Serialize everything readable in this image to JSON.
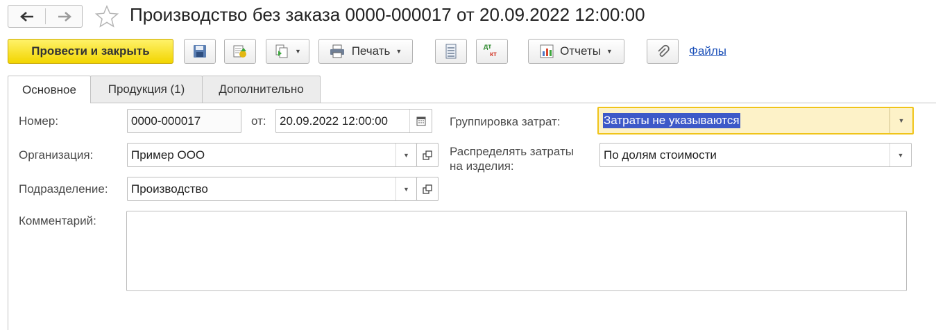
{
  "window": {
    "title": "Производство без заказа 0000-000017 от 20.09.2022 12:00:00"
  },
  "nav": {
    "back_icon": "arrow-left-icon",
    "forward_icon": "arrow-right-icon",
    "favorite_icon": "star-icon"
  },
  "toolbar": {
    "post_and_close_label": "Провести и закрыть",
    "print_label": "Печать",
    "reports_label": "Отчеты",
    "files_link": "Файлы",
    "icons": [
      "save-icon",
      "post-icon",
      "create-based-on-icon",
      "printer-icon",
      "list-icon",
      "dt-kt-icon",
      "reports-icon",
      "attachment-icon"
    ],
    "dt_text": "дт",
    "kt_text": "кт"
  },
  "tabs": [
    {
      "label": "Основное",
      "active": true
    },
    {
      "label": "Продукция (1)",
      "active": false
    },
    {
      "label": "Дополнительно",
      "active": false
    }
  ],
  "form": {
    "number_label": "Номер:",
    "number_value": "0000-000017",
    "date_label": "от:",
    "date_value": "20.09.2022 12:00:00",
    "organization_label": "Организация:",
    "organization_value": "Пример ООО",
    "department_label": "Подразделение:",
    "department_value": "Производство",
    "comment_label": "Комментарий:",
    "comment_value": "",
    "cost_grouping_label": "Группировка затрат:",
    "cost_grouping_value": "Затраты не указываются",
    "distribute_label_line1": "Распределять затраты",
    "distribute_label_line2": "на изделия:",
    "distribute_value": "По долям стоимости"
  },
  "colors": {
    "primary_button": "#f2d500",
    "focus_border": "#f0c419",
    "focus_bg": "#fdf2c8",
    "selection": "#3d59c8",
    "link": "#1a4fb8"
  }
}
